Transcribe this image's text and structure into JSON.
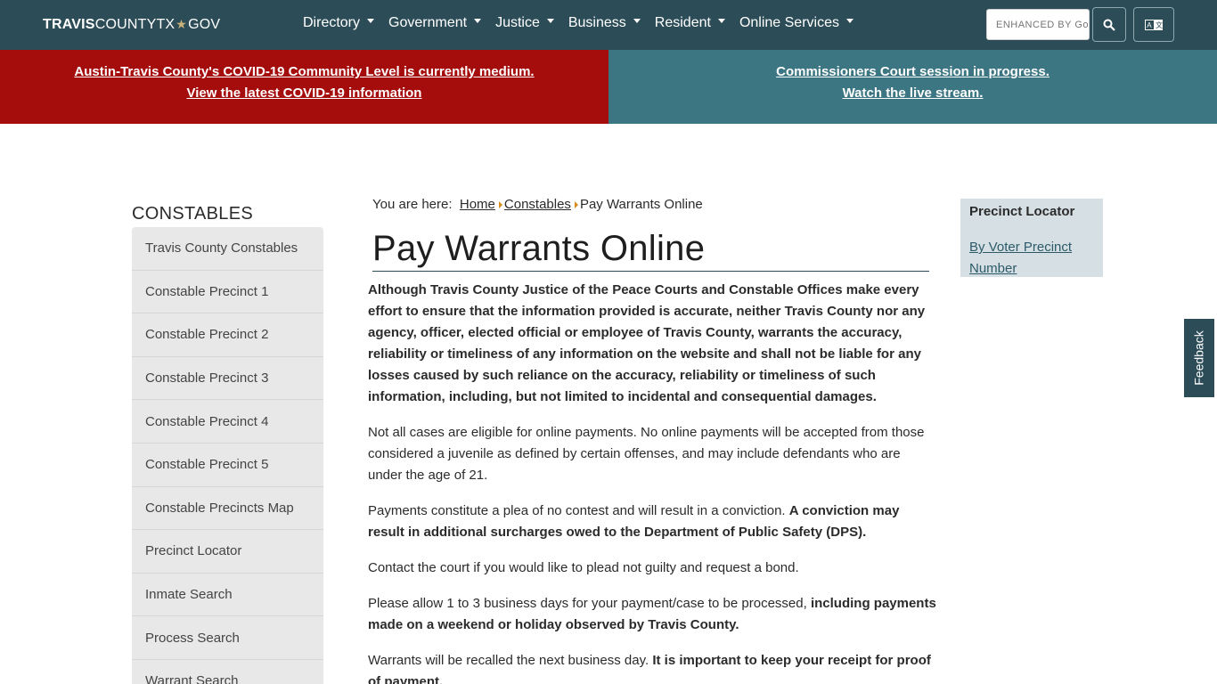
{
  "header": {
    "logo_bold": "TRAVIS",
    "logo_mid": "COUNTYTX",
    "logo_star": "★",
    "logo_end": "GOV",
    "nav": [
      "Directory",
      "Government",
      "Justice",
      "Business",
      "Resident",
      "Online Services"
    ],
    "search_placeholder": "ENHANCED BY Go",
    "icons": {
      "search": "search-icon",
      "translate": "translate-icon"
    }
  },
  "alerts": {
    "left": {
      "line1": "Austin-Travis County's COVID-19 Community Level is currently medium.",
      "line2": "View the latest COVID-19 information",
      "color": "#a50c0c"
    },
    "right": {
      "line1": "Commissioners Court session in progress.",
      "line2": "Watch the live stream.",
      "color": "#3d7683"
    }
  },
  "sidebar": {
    "title": "CONSTABLES",
    "items": [
      "Travis County Constables",
      "Constable Precinct 1",
      "Constable Precinct 2",
      "Constable Precinct 3",
      "Constable Precinct 4",
      "Constable Precinct 5",
      "Constable Precincts Map",
      "Precinct Locator",
      "Inmate Search",
      "Process Search",
      "Warrant Search"
    ]
  },
  "breadcrumb": {
    "prefix": "You are here:",
    "home": "Home",
    "section": "Constables",
    "current": "Pay Warrants Online"
  },
  "page": {
    "title": "Pay Warrants Online",
    "disclaimer": "Although Travis County Justice of the Peace Courts and Constable Offices make every effort to ensure that the information provided is accurate, neither Travis County nor any agency, officer, elected official or employee of Travis County, warrants the accuracy, reliability or timeliness of any information on the website and shall not be liable for any losses caused by such reliance on the accuracy, reliability or timeliness of such information, including, but not limited to incidental and consequential damages.",
    "p_eligibility": "Not all cases are eligible for online payments. No online payments will be accepted from those considered a juvenile as defined by certain offenses, and may include defendants who are under the age of 21.",
    "p_plea": "Payments constitute a plea of no contest and will result in a conviction.",
    "p_plea_bold": "A conviction may result in additional surcharges owed to the Department of Public Safety (DPS).",
    "p_contact": "Contact the court if you would like to plead not guilty and request a bond.",
    "p_allow": "Please allow 1 to 3 business days for your payment/case to be processed,",
    "p_allow_bold": "including payments made on a weekend or holiday observed by Travis County.",
    "p_recall": "Warrants will be recalled the next business day.",
    "p_recall_bold": "It is important to keep your receipt for proof of payment."
  },
  "locator": {
    "title": "Precinct Locator",
    "link": "By Voter Precinct Number"
  },
  "feedback": {
    "label": "Feedback"
  }
}
